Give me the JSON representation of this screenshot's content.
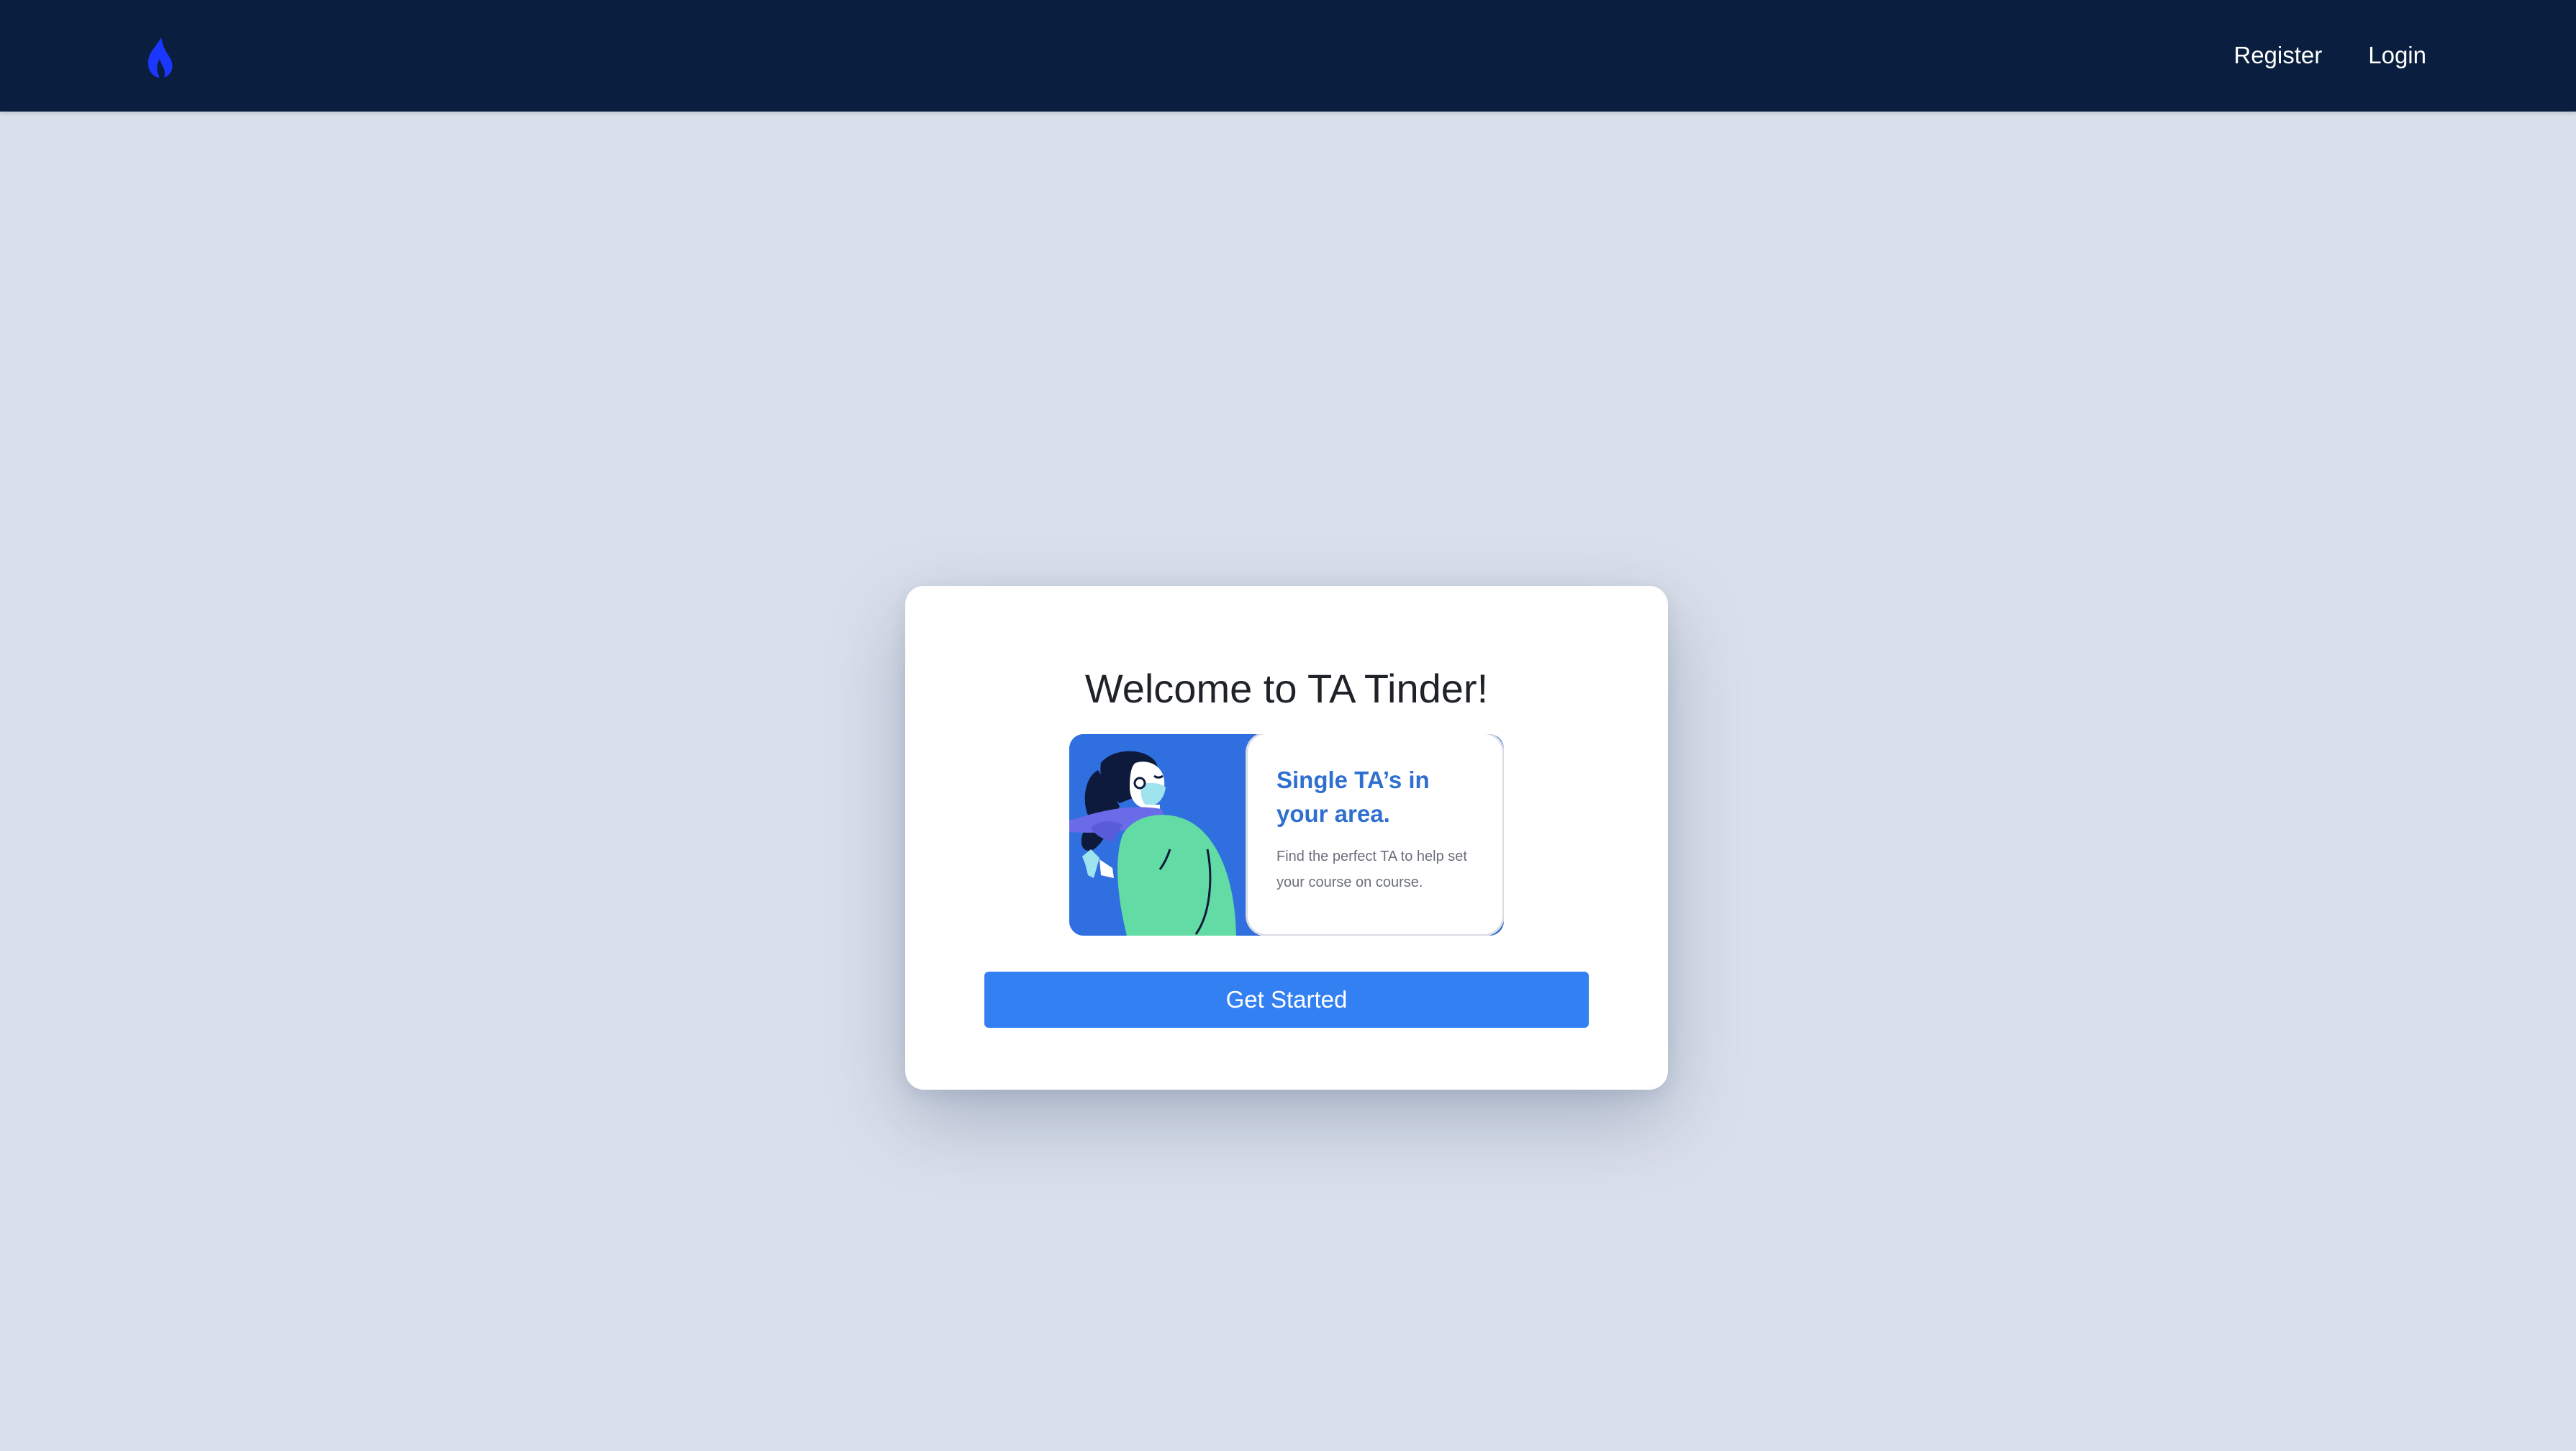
{
  "nav": {
    "logo_icon": "flame-icon",
    "links": [
      {
        "label": "Register"
      },
      {
        "label": "Login"
      }
    ]
  },
  "welcome_card": {
    "title": "Welcome to TA Tinder!",
    "promo": {
      "heading": "Single TA’s in your area.",
      "text": "Find the perfect TA to help set your course on course.",
      "illustration": "person-with-scarf-illustration"
    },
    "cta_label": "Get Started"
  },
  "colors": {
    "navbar": "#0a1f3f",
    "background": "#dae0eb",
    "accent": "#3380f2",
    "logo": "#1a36ff"
  }
}
